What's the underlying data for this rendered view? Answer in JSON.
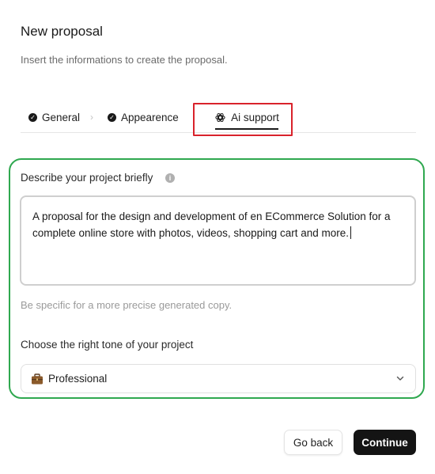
{
  "header": {
    "title": "New proposal",
    "subtitle": "Insert the informations to create the proposal."
  },
  "tabs": [
    {
      "label": "General",
      "state": "completed"
    },
    {
      "label": "Appearence",
      "state": "completed"
    },
    {
      "label": "Ai support",
      "state": "active"
    }
  ],
  "tab_separator": "›",
  "form": {
    "description_label": "Describe your project briefly",
    "description_value": "A proposal for the design and development of en ECommerce Solution for a complete online store with photos, videos, shopping cart and more.",
    "hint": "Be specific for a more precise generated copy.",
    "tone_label": "Choose the right tone of your project",
    "tone_value": "Professional"
  },
  "actions": {
    "back_label": "Go back",
    "continue_label": "Continue"
  },
  "colors": {
    "active_tab_highlight": "#d9222b",
    "panel_highlight": "#2fa84f",
    "primary_button": "#141414"
  }
}
